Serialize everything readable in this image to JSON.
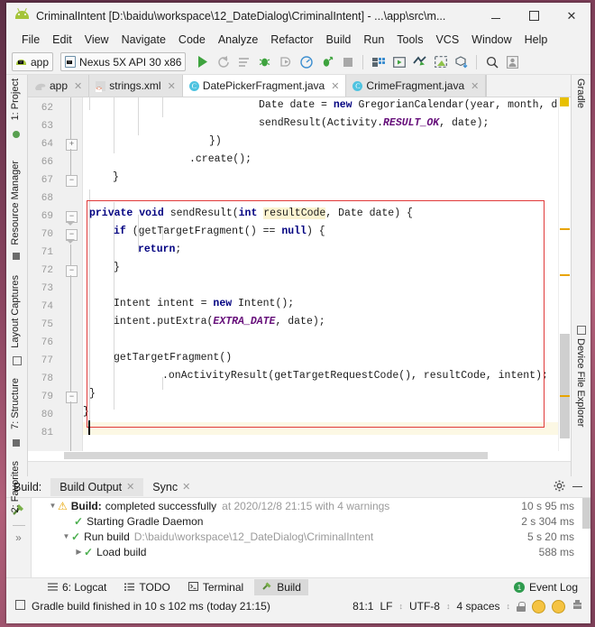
{
  "window": {
    "title": "CriminalIntent [D:\\baidu\\workspace\\12_DateDialog\\CriminalIntent] - ...\\app\\src\\m...",
    "app_icon": "android-robot-icon",
    "minimize": "—",
    "maximize": "□",
    "close": "✕"
  },
  "menubar": {
    "items": [
      "File",
      "Edit",
      "View",
      "Navigate",
      "Code",
      "Analyze",
      "Refactor",
      "Build",
      "Run",
      "Tools",
      "VCS",
      "Window",
      "Help"
    ]
  },
  "toolbar": {
    "module_selector": "app",
    "device_selector": "Nexus 5X API 30 x86",
    "icons": [
      "run-icon",
      "apply-changes-icon",
      "apply-code-changes-icon",
      "debug-icon",
      "attach-debugger-icon",
      "profiler-icon",
      "run-with-coverage-icon",
      "stop-icon",
      "sdk-manager-icon",
      "avd-manager-icon",
      "sync-gradle-icon",
      "layout-inspector-icon",
      "device-manager-icon",
      "search-icon",
      "avatar-icon"
    ]
  },
  "editor_tabs": [
    {
      "label": "app",
      "icon": "android-module-icon",
      "active": false,
      "closable": true
    },
    {
      "label": "strings.xml",
      "icon": "xml-file-icon",
      "active": false,
      "closable": true
    },
    {
      "label": "DatePickerFragment.java",
      "icon": "java-class-icon",
      "active": true,
      "closable": true
    },
    {
      "label": "CrimeFragment.java",
      "icon": "java-class-icon",
      "active": false,
      "closable": true
    }
  ],
  "left_toolwindows": [
    {
      "label": "1: Project",
      "icon": "project-icon"
    },
    {
      "label": "Resource Manager",
      "icon": "resource-icon"
    },
    {
      "label": "Layout Captures",
      "icon": "capture-icon"
    },
    {
      "label": "7: Structure",
      "icon": "structure-icon"
    },
    {
      "label": "2: Favorites",
      "icon": "star-icon"
    }
  ],
  "right_toolwindows": [
    {
      "label": "Gradle",
      "icon": "gradle-icon"
    },
    {
      "label": "Device File Explorer",
      "icon": "device-icon"
    }
  ],
  "editor": {
    "language": "java",
    "caret_position": "81:1",
    "lines": [
      {
        "num": "62",
        "text": "                        Date date = new GregorianCalendar(year, month, day).getTime"
      },
      {
        "num": "63",
        "text": "                        sendResult(Activity.RESULT_OK, date);"
      },
      {
        "num": "64",
        "text": "                    })"
      },
      {
        "num": "66",
        "text": "                .create();"
      },
      {
        "num": "67",
        "text": "    }"
      },
      {
        "num": "68",
        "text": ""
      },
      {
        "num": "69",
        "text": "    private void sendResult(int resultCode, Date date) {"
      },
      {
        "num": "70",
        "text": "        if (getTargetFragment() == null) {"
      },
      {
        "num": "71",
        "text": "            return;"
      },
      {
        "num": "72",
        "text": "        }"
      },
      {
        "num": "73",
        "text": ""
      },
      {
        "num": "74",
        "text": "        Intent intent = new Intent();"
      },
      {
        "num": "75",
        "text": "        intent.putExtra(EXTRA_DATE, date);"
      },
      {
        "num": "76",
        "text": ""
      },
      {
        "num": "77",
        "text": "        getTargetFragment()"
      },
      {
        "num": "78",
        "text": "                .onActivityResult(getTargetRequestCode(), resultCode, intent);"
      },
      {
        "num": "79",
        "text": "    }"
      },
      {
        "num": "80",
        "text": "}"
      },
      {
        "num": "81",
        "text": ""
      }
    ]
  },
  "build_panel": {
    "label": "Build:",
    "tabs": [
      {
        "label": "Build Output",
        "active": true,
        "closable": true
      },
      {
        "label": "Sync",
        "active": false,
        "closable": true
      }
    ],
    "settings_icon": "gear-icon",
    "hide_icon": "minimize-icon",
    "toggle_icon": "expand-icon",
    "rows": [
      {
        "indent": 0,
        "arrow": "▼",
        "status": "warning",
        "title": "Build:",
        "text": "completed successfully",
        "meta": "at 2020/12/8 21:15  with 4 warnings",
        "duration": "10 s 95 ms"
      },
      {
        "indent": 1,
        "arrow": "",
        "status": "ok",
        "title": "",
        "text": "Starting Gradle Daemon",
        "meta": "",
        "duration": "2 s 304 ms"
      },
      {
        "indent": 1,
        "arrow": "▼",
        "status": "ok",
        "title": "",
        "text": "Run build",
        "meta": "D:\\baidu\\workspace\\12_DateDialog\\CriminalIntent",
        "duration": "5 s 20 ms"
      },
      {
        "indent": 2,
        "arrow": "▶",
        "status": "ok",
        "title": "",
        "text": "Load build",
        "meta": "",
        "duration": "588 ms"
      }
    ]
  },
  "bottom_toolwindows": [
    {
      "label": "6: Logcat",
      "icon": "logcat-icon",
      "active": false
    },
    {
      "label": "TODO",
      "icon": "todo-icon",
      "active": false
    },
    {
      "label": "Terminal",
      "icon": "terminal-icon",
      "active": false
    },
    {
      "label": "Build",
      "icon": "build-hammer-icon",
      "active": true
    }
  ],
  "event_log": {
    "label": "Event Log",
    "count": "1"
  },
  "statusbar": {
    "message": "Gradle build finished in 10 s 102 ms (today 21:15)",
    "caret": "81:1",
    "line_separator": "LF",
    "encoding": "UTF-8",
    "indent": "4 spaces",
    "lock_icon": "lock-icon",
    "happy_icon": "smiley-happy-icon",
    "sad_icon": "smiley-sad-icon",
    "inspector_icon": "inspection-icon",
    "separator": "↕"
  },
  "colors": {
    "keyword": "#000080",
    "static_field": "#660e7a",
    "error_box": "#e03a3a",
    "warning_mark": "#e8a400",
    "success": "#4caf50",
    "accent_green": "#a4c439",
    "tab_active_bg": "#ffffff",
    "chrome_bg": "#f2f2f2"
  }
}
